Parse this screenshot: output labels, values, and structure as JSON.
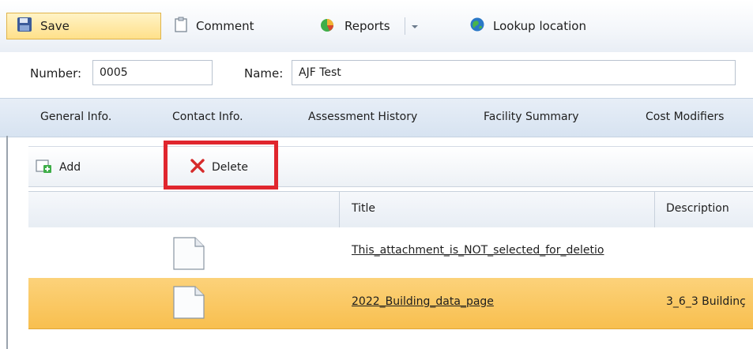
{
  "toolbar": {
    "save": "Save",
    "comment": "Comment",
    "reports": "Reports",
    "lookup": "Lookup location"
  },
  "form": {
    "number_label": "Number:",
    "number_value": "0005",
    "name_label": "Name:",
    "name_value": "AJF Test"
  },
  "tabs": [
    "General Info.",
    "Contact Info.",
    "Assessment History",
    "Facility Summary",
    "Cost Modifiers"
  ],
  "actions": {
    "add": "Add",
    "delete": "Delete"
  },
  "grid": {
    "columns": [
      "",
      "Title",
      "Description"
    ],
    "rows": [
      {
        "title": "This_attachment_is_NOT_selected_for_deletio",
        "description": "",
        "selected": false
      },
      {
        "title": "2022_Building_data_page",
        "description": "3_6_3 Buildinç",
        "selected": true
      }
    ]
  },
  "colors": {
    "highlight": "#e0262e",
    "selected_row": "#f8bf4f",
    "save_button": "#ffe08a"
  }
}
